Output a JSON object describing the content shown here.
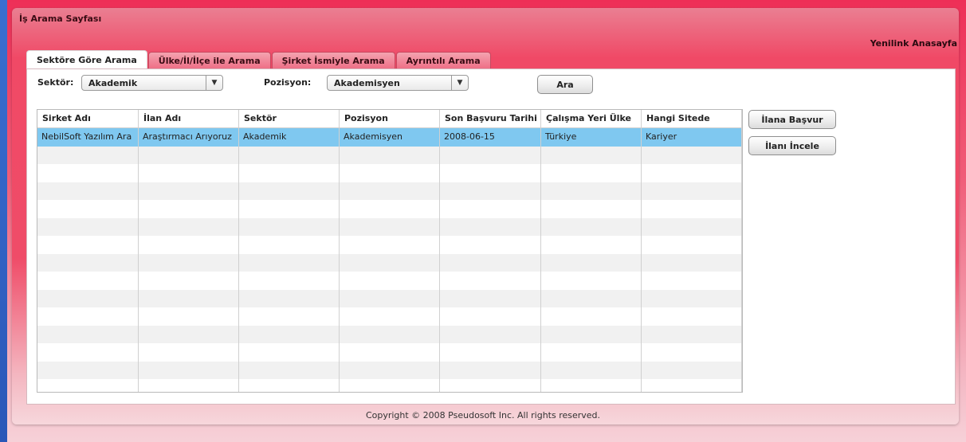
{
  "page": {
    "title": "İş Arama Sayfası",
    "home_link": "Yenilink Anasayfa",
    "footer": "Copyright © 2008 Pseudosoft Inc. All rights reserved."
  },
  "tabs": [
    {
      "label": "Sektöre Göre Arama",
      "active": true
    },
    {
      "label": "Ülke/İl/İlçe ile Arama",
      "active": false
    },
    {
      "label": "Şirket İsmiyle Arama",
      "active": false
    },
    {
      "label": "Ayrıntılı Arama",
      "active": false
    }
  ],
  "filters": {
    "sector_label": "Sektör:",
    "sector_value": "Akademik",
    "position_label": "Pozisyon:",
    "position_value": "Akademisyen",
    "search_button": "Ara"
  },
  "actions": {
    "apply_button": "İlana Başvur",
    "inspect_button": "İlanı İncele"
  },
  "table": {
    "columns": [
      "Sirket Adı",
      "İlan Adı",
      "Sektör",
      "Pozisyon",
      "Son Başvuru Tarihi",
      "Çalışma Yeri Ülke",
      "Hangi Sitede"
    ],
    "rows": [
      [
        "NebilSoft Yazılım Ara",
        "Araştırmacı Arıyoruz",
        "Akademik",
        "Akademisyen",
        "2008-06-15",
        "Türkiye",
        "Kariyer"
      ]
    ],
    "selected_row": 0
  },
  "colors": {
    "frame_accent": "#ee2f57",
    "selected_row": "#7fc8f0",
    "left_strip": "#3b6fd0"
  },
  "icons": {
    "dropdown": "chevron-down-icon"
  }
}
